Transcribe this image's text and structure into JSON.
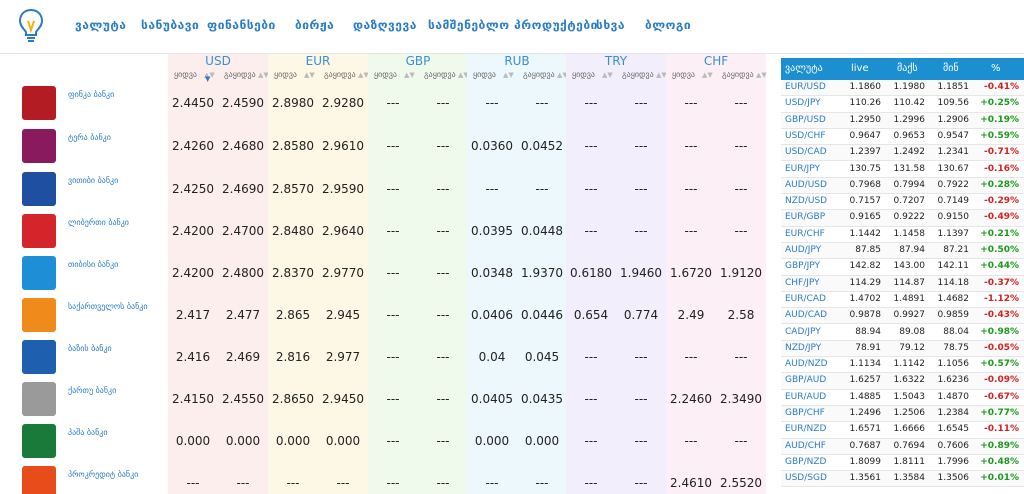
{
  "nav": {
    "items": [
      "ვალუტა",
      "სანუბავი",
      "ფინანსები",
      "ბირჟა",
      "დაზღვევა",
      "სამშენებლო პროდუქტები",
      "სხვა",
      "ბლოგი"
    ]
  },
  "currencies": [
    "USD",
    "EUR",
    "GBP",
    "RUB",
    "TRY",
    "CHF"
  ],
  "subheads": {
    "buy": "ყიდვა",
    "sell": "გაყიდვა"
  },
  "banks": [
    {
      "name": "ფინკა ბანკი",
      "logo_color": "#b41c24",
      "values": [
        "2.4450",
        "2.4590",
        "2.8980",
        "2.9280",
        "---",
        "---",
        "---",
        "---",
        "---",
        "---",
        "---",
        "---"
      ]
    },
    {
      "name": "ტერა ბანკი",
      "logo_color": "#8a1a5e",
      "values": [
        "2.4260",
        "2.4680",
        "2.8580",
        "2.9610",
        "---",
        "---",
        "0.0360",
        "0.0452",
        "---",
        "---",
        "---",
        "---"
      ]
    },
    {
      "name": "ვითიბი ბანკი",
      "logo_color": "#1e4fa0",
      "values": [
        "2.4250",
        "2.4690",
        "2.8570",
        "2.9590",
        "---",
        "---",
        "---",
        "---",
        "---",
        "---",
        "---",
        "---"
      ]
    },
    {
      "name": "ლიბერთი ბანკი",
      "logo_color": "#d4252b",
      "values": [
        "2.4200",
        "2.4700",
        "2.8480",
        "2.9640",
        "---",
        "---",
        "0.0395",
        "0.0448",
        "---",
        "---",
        "---",
        "---"
      ]
    },
    {
      "name": "თიბისი ბანკი",
      "logo_color": "#1e8fd6",
      "values": [
        "2.4200",
        "2.4800",
        "2.8370",
        "2.9770",
        "---",
        "---",
        "0.0348",
        "1.9370",
        "0.6180",
        "1.9460",
        "1.6720",
        "1.9120"
      ]
    },
    {
      "name": "საქართველოს ბანკი",
      "logo_color": "#f08a1a",
      "values": [
        "2.417",
        "2.477",
        "2.865",
        "2.945",
        "---",
        "---",
        "0.0406",
        "0.0446",
        "0.654",
        "0.774",
        "2.49",
        "2.58"
      ]
    },
    {
      "name": "ბაზის ბანკი",
      "logo_color": "#1e5fb0",
      "values": [
        "2.416",
        "2.469",
        "2.816",
        "2.977",
        "---",
        "---",
        "0.04",
        "0.045",
        "---",
        "---",
        "---",
        "---"
      ]
    },
    {
      "name": "ქართუ ბანკი",
      "logo_color": "#9a9a9a",
      "values": [
        "2.4150",
        "2.4550",
        "2.8650",
        "2.9450",
        "---",
        "---",
        "0.0405",
        "0.0435",
        "---",
        "---",
        "2.2460",
        "2.3490"
      ]
    },
    {
      "name": "პაშა ბანკი",
      "logo_color": "#1a7a3a",
      "values": [
        "0.000",
        "0.000",
        "0.000",
        "0.000",
        "---",
        "---",
        "0.000",
        "0.000",
        "---",
        "---",
        "---",
        "---"
      ]
    },
    {
      "name": "პროკრედიტ ბანკი",
      "logo_color": "#e84c1a",
      "values": [
        "---",
        "---",
        "---",
        "---",
        "---",
        "---",
        "---",
        "---",
        "---",
        "---",
        "2.4610",
        "2.5520"
      ]
    }
  ],
  "rates_table": {
    "headers": [
      "ვალუტა",
      "live",
      "მაქს",
      "მინ",
      "%"
    ],
    "rows": [
      [
        "EUR/USD",
        "1.1860",
        "1.1980",
        "1.1851",
        "-0.41%"
      ],
      [
        "USD/JPY",
        "110.26",
        "110.42",
        "109.56",
        "+0.25%"
      ],
      [
        "GBP/USD",
        "1.2950",
        "1.2996",
        "1.2906",
        "+0.19%"
      ],
      [
        "USD/CHF",
        "0.9647",
        "0.9653",
        "0.9547",
        "+0.59%"
      ],
      [
        "USD/CAD",
        "1.2397",
        "1.2492",
        "1.2341",
        "-0.71%"
      ],
      [
        "EUR/JPY",
        "130.75",
        "131.58",
        "130.67",
        "-0.16%"
      ],
      [
        "AUD/USD",
        "0.7968",
        "0.7994",
        "0.7922",
        "+0.28%"
      ],
      [
        "NZD/USD",
        "0.7157",
        "0.7207",
        "0.7149",
        "-0.29%"
      ],
      [
        "EUR/GBP",
        "0.9165",
        "0.9222",
        "0.9150",
        "-0.49%"
      ],
      [
        "EUR/CHF",
        "1.1442",
        "1.1458",
        "1.1397",
        "+0.21%"
      ],
      [
        "AUD/JPY",
        "87.85",
        "87.94",
        "87.21",
        "+0.50%"
      ],
      [
        "GBP/JPY",
        "142.82",
        "143.00",
        "142.11",
        "+0.44%"
      ],
      [
        "CHF/JPY",
        "114.29",
        "114.87",
        "114.18",
        "-0.37%"
      ],
      [
        "EUR/CAD",
        "1.4702",
        "1.4891",
        "1.4682",
        "-1.12%"
      ],
      [
        "AUD/CAD",
        "0.9878",
        "0.9927",
        "0.9859",
        "-0.43%"
      ],
      [
        "CAD/JPY",
        "88.94",
        "89.08",
        "88.04",
        "+0.98%"
      ],
      [
        "NZD/JPY",
        "78.91",
        "79.12",
        "78.75",
        "-0.05%"
      ],
      [
        "AUD/NZD",
        "1.1134",
        "1.1142",
        "1.1056",
        "+0.57%"
      ],
      [
        "GBP/AUD",
        "1.6257",
        "1.6322",
        "1.6236",
        "-0.09%"
      ],
      [
        "EUR/AUD",
        "1.4885",
        "1.5043",
        "1.4870",
        "-0.67%"
      ],
      [
        "GBP/CHF",
        "1.2496",
        "1.2506",
        "1.2384",
        "+0.77%"
      ],
      [
        "EUR/NZD",
        "1.6571",
        "1.6666",
        "1.6545",
        "-0.11%"
      ],
      [
        "AUD/CHF",
        "0.7687",
        "0.7694",
        "0.7606",
        "+0.89%"
      ],
      [
        "GBP/NZD",
        "1.8099",
        "1.8111",
        "1.7996",
        "+0.48%"
      ],
      [
        "USD/SGD",
        "1.3561",
        "1.3584",
        "1.3506",
        "+0.01%"
      ]
    ]
  }
}
